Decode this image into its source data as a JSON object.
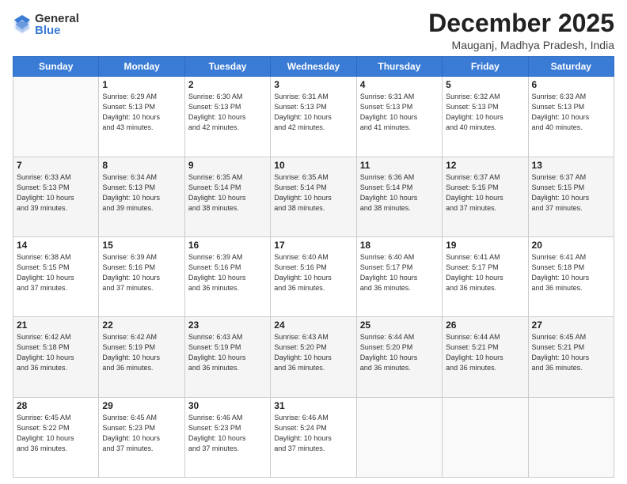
{
  "logo": {
    "general": "General",
    "blue": "Blue"
  },
  "header": {
    "month": "December 2025",
    "location": "Mauganj, Madhya Pradesh, India"
  },
  "days_of_week": [
    "Sunday",
    "Monday",
    "Tuesday",
    "Wednesday",
    "Thursday",
    "Friday",
    "Saturday"
  ],
  "weeks": [
    [
      {
        "day": "",
        "info": ""
      },
      {
        "day": "1",
        "info": "Sunrise: 6:29 AM\nSunset: 5:13 PM\nDaylight: 10 hours\nand 43 minutes."
      },
      {
        "day": "2",
        "info": "Sunrise: 6:30 AM\nSunset: 5:13 PM\nDaylight: 10 hours\nand 42 minutes."
      },
      {
        "day": "3",
        "info": "Sunrise: 6:31 AM\nSunset: 5:13 PM\nDaylight: 10 hours\nand 42 minutes."
      },
      {
        "day": "4",
        "info": "Sunrise: 6:31 AM\nSunset: 5:13 PM\nDaylight: 10 hours\nand 41 minutes."
      },
      {
        "day": "5",
        "info": "Sunrise: 6:32 AM\nSunset: 5:13 PM\nDaylight: 10 hours\nand 40 minutes."
      },
      {
        "day": "6",
        "info": "Sunrise: 6:33 AM\nSunset: 5:13 PM\nDaylight: 10 hours\nand 40 minutes."
      }
    ],
    [
      {
        "day": "7",
        "info": "Sunrise: 6:33 AM\nSunset: 5:13 PM\nDaylight: 10 hours\nand 39 minutes."
      },
      {
        "day": "8",
        "info": "Sunrise: 6:34 AM\nSunset: 5:13 PM\nDaylight: 10 hours\nand 39 minutes."
      },
      {
        "day": "9",
        "info": "Sunrise: 6:35 AM\nSunset: 5:14 PM\nDaylight: 10 hours\nand 38 minutes."
      },
      {
        "day": "10",
        "info": "Sunrise: 6:35 AM\nSunset: 5:14 PM\nDaylight: 10 hours\nand 38 minutes."
      },
      {
        "day": "11",
        "info": "Sunrise: 6:36 AM\nSunset: 5:14 PM\nDaylight: 10 hours\nand 38 minutes."
      },
      {
        "day": "12",
        "info": "Sunrise: 6:37 AM\nSunset: 5:15 PM\nDaylight: 10 hours\nand 37 minutes."
      },
      {
        "day": "13",
        "info": "Sunrise: 6:37 AM\nSunset: 5:15 PM\nDaylight: 10 hours\nand 37 minutes."
      }
    ],
    [
      {
        "day": "14",
        "info": "Sunrise: 6:38 AM\nSunset: 5:15 PM\nDaylight: 10 hours\nand 37 minutes."
      },
      {
        "day": "15",
        "info": "Sunrise: 6:39 AM\nSunset: 5:16 PM\nDaylight: 10 hours\nand 37 minutes."
      },
      {
        "day": "16",
        "info": "Sunrise: 6:39 AM\nSunset: 5:16 PM\nDaylight: 10 hours\nand 36 minutes."
      },
      {
        "day": "17",
        "info": "Sunrise: 6:40 AM\nSunset: 5:16 PM\nDaylight: 10 hours\nand 36 minutes."
      },
      {
        "day": "18",
        "info": "Sunrise: 6:40 AM\nSunset: 5:17 PM\nDaylight: 10 hours\nand 36 minutes."
      },
      {
        "day": "19",
        "info": "Sunrise: 6:41 AM\nSunset: 5:17 PM\nDaylight: 10 hours\nand 36 minutes."
      },
      {
        "day": "20",
        "info": "Sunrise: 6:41 AM\nSunset: 5:18 PM\nDaylight: 10 hours\nand 36 minutes."
      }
    ],
    [
      {
        "day": "21",
        "info": "Sunrise: 6:42 AM\nSunset: 5:18 PM\nDaylight: 10 hours\nand 36 minutes."
      },
      {
        "day": "22",
        "info": "Sunrise: 6:42 AM\nSunset: 5:19 PM\nDaylight: 10 hours\nand 36 minutes."
      },
      {
        "day": "23",
        "info": "Sunrise: 6:43 AM\nSunset: 5:19 PM\nDaylight: 10 hours\nand 36 minutes."
      },
      {
        "day": "24",
        "info": "Sunrise: 6:43 AM\nSunset: 5:20 PM\nDaylight: 10 hours\nand 36 minutes."
      },
      {
        "day": "25",
        "info": "Sunrise: 6:44 AM\nSunset: 5:20 PM\nDaylight: 10 hours\nand 36 minutes."
      },
      {
        "day": "26",
        "info": "Sunrise: 6:44 AM\nSunset: 5:21 PM\nDaylight: 10 hours\nand 36 minutes."
      },
      {
        "day": "27",
        "info": "Sunrise: 6:45 AM\nSunset: 5:21 PM\nDaylight: 10 hours\nand 36 minutes."
      }
    ],
    [
      {
        "day": "28",
        "info": "Sunrise: 6:45 AM\nSunset: 5:22 PM\nDaylight: 10 hours\nand 36 minutes."
      },
      {
        "day": "29",
        "info": "Sunrise: 6:45 AM\nSunset: 5:23 PM\nDaylight: 10 hours\nand 37 minutes."
      },
      {
        "day": "30",
        "info": "Sunrise: 6:46 AM\nSunset: 5:23 PM\nDaylight: 10 hours\nand 37 minutes."
      },
      {
        "day": "31",
        "info": "Sunrise: 6:46 AM\nSunset: 5:24 PM\nDaylight: 10 hours\nand 37 minutes."
      },
      {
        "day": "",
        "info": ""
      },
      {
        "day": "",
        "info": ""
      },
      {
        "day": "",
        "info": ""
      }
    ]
  ]
}
